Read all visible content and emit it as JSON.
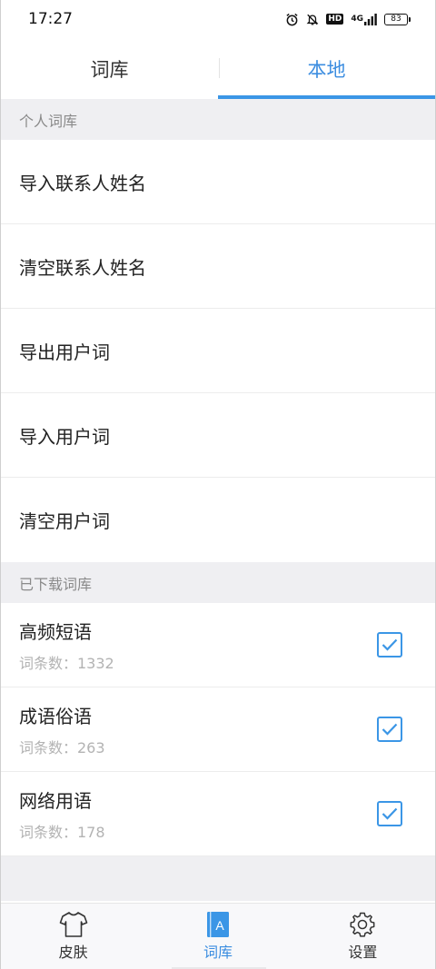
{
  "status_bar": {
    "time": "17:27",
    "hd": "HD",
    "network": "4G",
    "battery": "83",
    "icons": [
      "alarm-icon",
      "bell-off-icon",
      "hd-icon",
      "signal-icon",
      "battery-icon"
    ]
  },
  "tabs": [
    {
      "label": "词库",
      "active": false
    },
    {
      "label": "本地",
      "active": true
    }
  ],
  "personal_section": {
    "header": "个人词库",
    "items": [
      "导入联系人姓名",
      "清空联系人姓名",
      "导出用户词",
      "导入用户词",
      "清空用户词"
    ]
  },
  "downloaded_section": {
    "header": "已下载词库",
    "items": [
      {
        "name": "高频短语",
        "count": "词条数：1332",
        "checked": true
      },
      {
        "name": "成语俗语",
        "count": "词条数：263",
        "checked": true
      },
      {
        "name": "网络用语",
        "count": "词条数：178",
        "checked": true
      }
    ]
  },
  "bottom_nav": [
    {
      "label": "皮肤",
      "icon": "shirt-icon",
      "active": false
    },
    {
      "label": "词库",
      "icon": "dictionary-icon",
      "active": true
    },
    {
      "label": "设置",
      "icon": "gear-icon",
      "active": false
    }
  ],
  "colors": {
    "accent": "#3b96e6",
    "section_bg": "#efeff2",
    "muted_text": "#b3b3b3"
  }
}
